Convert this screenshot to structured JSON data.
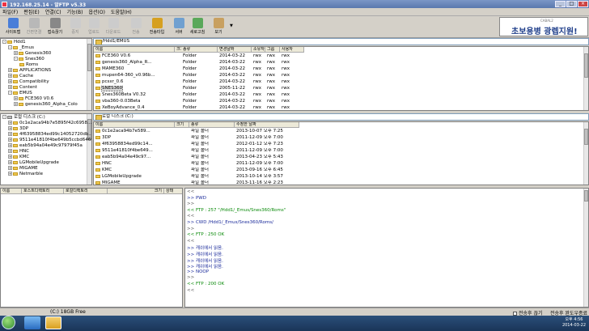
{
  "window": {
    "title": "192.168.25.14 - 알FTP v5.33",
    "controls": [
      "_",
      "□",
      "×"
    ]
  },
  "menu": [
    "파일(F)",
    "편집(E)",
    "연결(C)",
    "기능(B)",
    "옵션(O)",
    "도움말(H)"
  ],
  "toolbar": {
    "buttons": [
      {
        "label": "사이트맵",
        "color": "#4a7ed8",
        "disabled": false
      },
      {
        "label": "간편연결",
        "color": "#b8b8b8",
        "disabled": true
      },
      {
        "label": "접속끊기",
        "color": "#888888",
        "disabled": false
      },
      {
        "label": "중지",
        "color": "#cccccc",
        "disabled": true
      },
      {
        "label": "업로드",
        "color": "#cccccc",
        "disabled": true
      },
      {
        "label": "다운로드",
        "color": "#cccccc",
        "disabled": true
      },
      {
        "label": "전송",
        "color": "#cccccc",
        "disabled": true
      },
      {
        "label": "전송타입",
        "color": "#d6a020",
        "disabled": false
      },
      {
        "label": "서버",
        "color": "#70a0d0",
        "disabled": false
      },
      {
        "label": "새로고침",
        "color": "#5aa85a",
        "disabled": false
      },
      {
        "label": "보기",
        "color": "#c8a060",
        "disabled": false
      }
    ]
  },
  "banner": {
    "small": "CABAL2",
    "main": "초보용병 광렙지원!"
  },
  "remote_address": "/Hdd1/EMUS",
  "local_address": "로컬 디스크 (C:)",
  "remote_tree": [
    {
      "label": "Hdd1",
      "indent": 0,
      "exp": "-"
    },
    {
      "label": "_Emus",
      "indent": 1,
      "exp": "-"
    },
    {
      "label": "Genesis360",
      "indent": 2,
      "exp": "+"
    },
    {
      "label": "Snes360",
      "indent": 2,
      "exp": "-"
    },
    {
      "label": "Roms",
      "indent": 3,
      "exp": ""
    },
    {
      "label": "APPLICATIONS",
      "indent": 1,
      "exp": "+"
    },
    {
      "label": "Cache",
      "indent": 1,
      "exp": "+"
    },
    {
      "label": "Compatibility",
      "indent": 1,
      "exp": "+"
    },
    {
      "label": "Content",
      "indent": 1,
      "exp": "+"
    },
    {
      "label": "EMUS",
      "indent": 1,
      "exp": "-"
    },
    {
      "label": "FCE360 V0.6",
      "indent": 2,
      "exp": "+"
    },
    {
      "label": "genesis360_Alpha_Colo",
      "indent": 2,
      "exp": "+"
    }
  ],
  "remote_columns": [
    "이름",
    "크기",
    "종류",
    "변경날짜",
    "소유자",
    "그룹",
    "사용자"
  ],
  "remote_files": [
    {
      "name": "FCE360 V0.6",
      "size": "",
      "type": "Folder",
      "date": "2014-03-22",
      "owner": "rwx",
      "group": "rwx",
      "user": "rwx"
    },
    {
      "name": "genesis360_Alpha_R...",
      "size": "",
      "type": "Folder",
      "date": "2014-03-22",
      "owner": "rwx",
      "group": "rwx",
      "user": "rwx"
    },
    {
      "name": "MAME360",
      "size": "",
      "type": "Folder",
      "date": "2014-03-22",
      "owner": "rwx",
      "group": "rwx",
      "user": "rwx"
    },
    {
      "name": "mupen64-360_v0.96b...",
      "size": "",
      "type": "Folder",
      "date": "2014-03-22",
      "owner": "rwx",
      "group": "rwx",
      "user": "rwx"
    },
    {
      "name": "pcsxr_0.6",
      "size": "",
      "type": "Folder",
      "date": "2014-03-22",
      "owner": "rwx",
      "group": "rwx",
      "user": "rwx"
    },
    {
      "name": "SNES360",
      "size": "",
      "type": "Folder",
      "date": "2005-11-22",
      "owner": "rwx",
      "group": "rwx",
      "user": "rwx"
    },
    {
      "name": "Snes360Beta V0.32",
      "size": "",
      "type": "Folder",
      "date": "2014-03-22",
      "owner": "rwx",
      "group": "rwx",
      "user": "rwx"
    },
    {
      "name": "vba360-0.03Beta",
      "size": "",
      "type": "Folder",
      "date": "2014-03-22",
      "owner": "rwx",
      "group": "rwx",
      "user": "rwx"
    },
    {
      "name": "XeBoyAdvance_0.4",
      "size": "",
      "type": "Folder",
      "date": "2014-03-22",
      "owner": "rwx",
      "group": "rwx",
      "user": "rwx"
    }
  ],
  "local_tree": [
    {
      "label": "로컬 디스크 (C:)",
      "indent": 0,
      "exp": "-",
      "drive": true
    },
    {
      "label": "0c1e2aca94b7e5895f42c6958...",
      "indent": 1,
      "exp": "+"
    },
    {
      "label": "3DP",
      "indent": 1,
      "exp": "+"
    },
    {
      "label": "4f63958834ed99c14052720db...",
      "indent": 1,
      "exp": "+"
    },
    {
      "label": "9511e41810f4be649b5ccbd646f",
      "indent": 1,
      "exp": "+"
    },
    {
      "label": "eab5b94a04e49c97979f45a",
      "indent": 1,
      "exp": "+"
    },
    {
      "label": "HNC",
      "indent": 1,
      "exp": "+"
    },
    {
      "label": "KMC",
      "indent": 1,
      "exp": "+"
    },
    {
      "label": "LGMobileUpgrade",
      "indent": 1,
      "exp": "+"
    },
    {
      "label": "MIGAME",
      "indent": 1,
      "exp": "+"
    },
    {
      "label": "Netmarble",
      "indent": 1,
      "exp": "+"
    }
  ],
  "local_columns": [
    "이름",
    "크기",
    "종류",
    "수정한 날짜"
  ],
  "local_files": [
    {
      "name": "0c1e2aca94b7e589...",
      "type": "파일 폴더",
      "date": "2013-10-07 오후 7:25"
    },
    {
      "name": "3DP",
      "type": "파일 폴더",
      "date": "2011-12-09 오후 7:00"
    },
    {
      "name": "4f63958834ed99c14...",
      "type": "파일 폴더",
      "date": "2012-01-12 오후 7:23"
    },
    {
      "name": "9511e41810f4be649...",
      "type": "파일 폴더",
      "date": "2011-12-09 오후 7:00"
    },
    {
      "name": "eab5b94a04e49c97...",
      "type": "파일 폴더",
      "date": "2013-04-23 오후 5:43"
    },
    {
      "name": "HNC",
      "type": "파일 폴더",
      "date": "2011-12-09 오후 7:00"
    },
    {
      "name": "KMC",
      "type": "파일 폴더",
      "date": "2013-09-16 오후 6:45"
    },
    {
      "name": "LGMobileUpgrade",
      "type": "파일 폴더",
      "date": "2013-10-14 오후 3:57"
    },
    {
      "name": "MIGAME",
      "type": "파일 폴더",
      "date": "2013-11-16 오후 2:23"
    }
  ],
  "queue_columns": [
    "이름",
    "호스트디렉토리",
    "로컬디렉토리",
    "크기",
    "상태"
  ],
  "log": [
    {
      "text": "<<",
      "color": "gray"
    },
    {
      "text": ">> PWD",
      "color": "blue"
    },
    {
      "text": ">>",
      "color": "gray"
    },
    {
      "text": "<< FTP : 257 \"/Hdd1/_Emus/Snes360/Roms\"",
      "color": "green"
    },
    {
      "text": "<<",
      "color": "gray"
    },
    {
      "text": ">> CWD /Hdd1/_Emus/Snes360/Roms/",
      "color": "blue"
    },
    {
      "text": ">>",
      "color": "gray"
    },
    {
      "text": "<< FTP : 250 OK",
      "color": "green"
    },
    {
      "text": "<<",
      "color": "gray"
    },
    {
      "text": ">> 캐쉬에서 읽음.",
      "color": "blue"
    },
    {
      "text": ">> 캐쉬에서 읽음.",
      "color": "blue"
    },
    {
      "text": ">> 캐쉬에서 읽음.",
      "color": "blue"
    },
    {
      "text": ">> 캐쉬에서 읽음.",
      "color": "blue"
    },
    {
      "text": ">> NOOP",
      "color": "blue"
    },
    {
      "text": ">>",
      "color": "gray"
    },
    {
      "text": "<< FTP : 200 OK",
      "color": "green"
    },
    {
      "text": "<<",
      "color": "gray"
    }
  ],
  "status": {
    "free": "(C:) 18GB Free",
    "opt1": "전송후 끊기",
    "opt2": "전송후 완도우종료"
  },
  "taskbar": {
    "time": "오후 4:56",
    "date": "2014-03-22"
  }
}
